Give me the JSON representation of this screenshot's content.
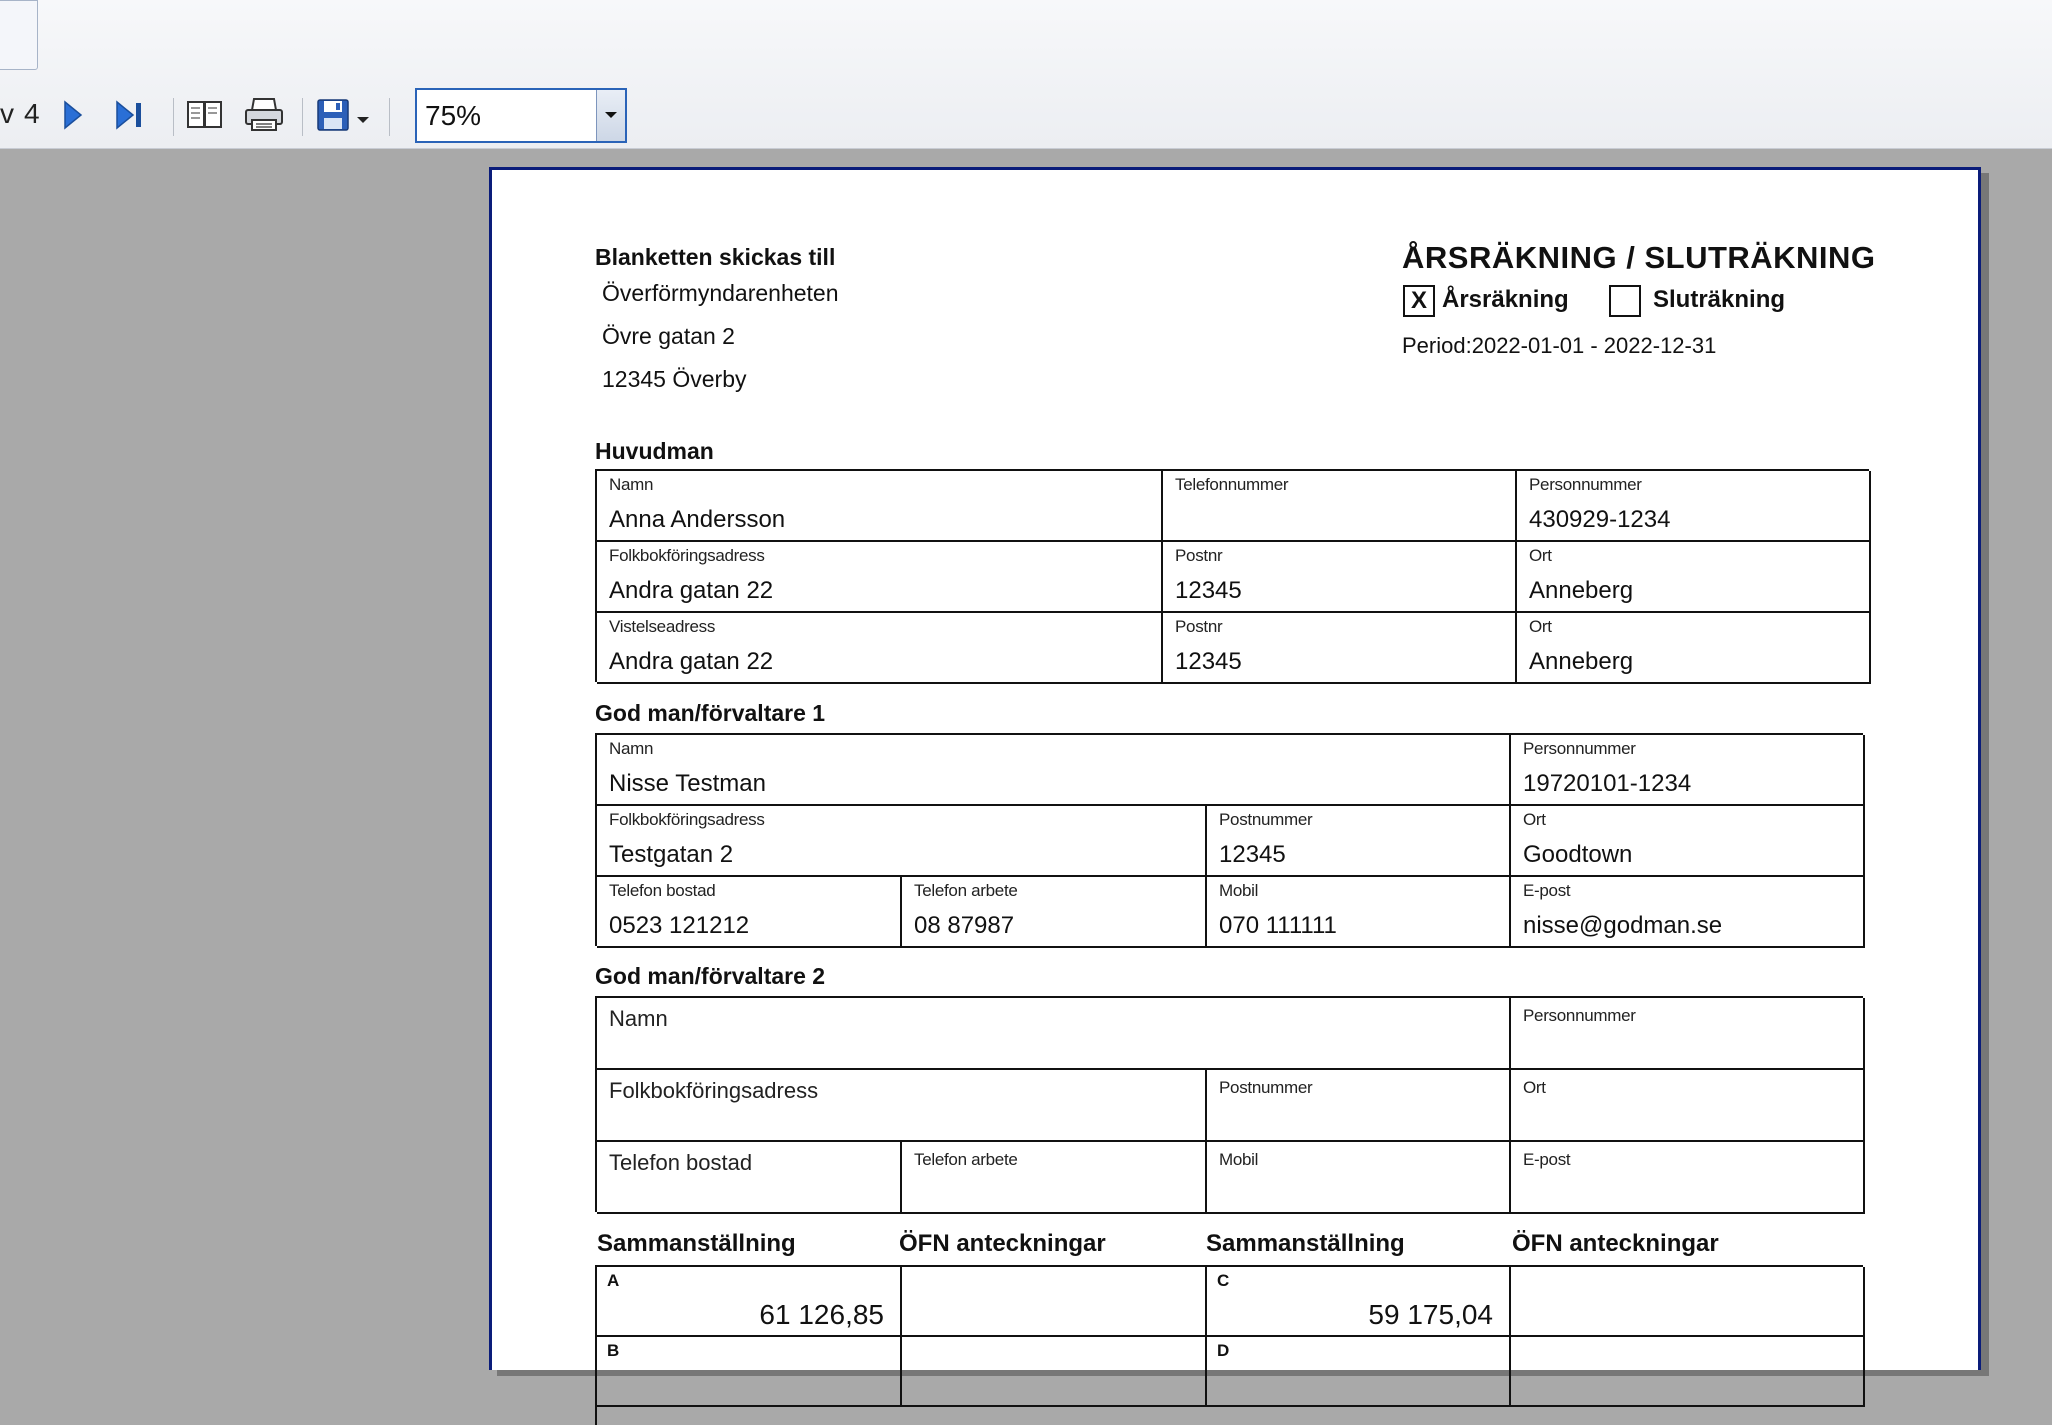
{
  "toolbar": {
    "page_prefix": "v",
    "page_total": "4",
    "zoom_value": "75%"
  },
  "form": {
    "send_to_label": "Blanketten skickas till",
    "recipient": {
      "name": "Överförmyndarenheten",
      "street": "Övre gatan 2",
      "city": "12345 Överby"
    },
    "title": "ÅRSRÄKNING / SLUTRÄKNING",
    "type_options": [
      {
        "label": "Årsräkning",
        "mark": "X"
      },
      {
        "label": "Sluträkning",
        "mark": ""
      }
    ],
    "period_label": "Period:",
    "period_value": "2022-01-01 - 2022-12-31",
    "huvudman": {
      "heading": "Huvudman",
      "name_label": "Namn",
      "name": "Anna Andersson",
      "phone_label": "Telefonnummer",
      "phone": "",
      "pnr_label": "Personnummer",
      "pnr": "430929-1234",
      "folk_label": "Folkbokföringsadress",
      "folk": "Andra gatan 22",
      "postnr_label": "Postnr",
      "postnr": "12345",
      "ort_label": "Ort",
      "ort": "Anneberg",
      "vistelse_label": "Vistelseadress",
      "vistelse": "Andra gatan 22",
      "postnr2_label": "Postnr",
      "postnr2": "12345",
      "ort2_label": "Ort",
      "ort2": "Anneberg"
    },
    "godman1": {
      "heading": "God man/förvaltare 1",
      "name_label": "Namn",
      "name": "Nisse Testman",
      "pnr_label": "Personnummer",
      "pnr": "19720101-1234",
      "folk_label": "Folkbokföringsadress",
      "folk": "Testgatan 2",
      "postnr_label": "Postnummer",
      "postnr": "12345",
      "ort_label": "Ort",
      "ort": "Goodtown",
      "tel_home_label": "Telefon bostad",
      "tel_home": "0523 121212",
      "tel_work_label": "Telefon arbete",
      "tel_work": "08 87987",
      "mobil_label": "Mobil",
      "mobil": "070 111111",
      "email_label": "E-post",
      "email": "nisse@godman.se"
    },
    "godman2": {
      "heading": "God man/förvaltare 2",
      "name_label": "Namn",
      "pnr_label": "Personnummer",
      "folk_label": "Folkbokföringsadress",
      "postnr_label": "Postnummer",
      "ort_label": "Ort",
      "tel_home_label": "Telefon bostad",
      "tel_work_label": "Telefon arbete",
      "mobil_label": "Mobil",
      "email_label": "E-post"
    },
    "summary": {
      "head_sum": "Sammanställning",
      "head_notes": "ÖFN  anteckningar",
      "rows": [
        {
          "left_letter": "A",
          "left_value": "61 126,85",
          "right_letter": "C",
          "right_value": "59 175,04"
        },
        {
          "left_letter": "B",
          "left_value": "",
          "right_letter": "D",
          "right_value": ""
        }
      ]
    }
  }
}
